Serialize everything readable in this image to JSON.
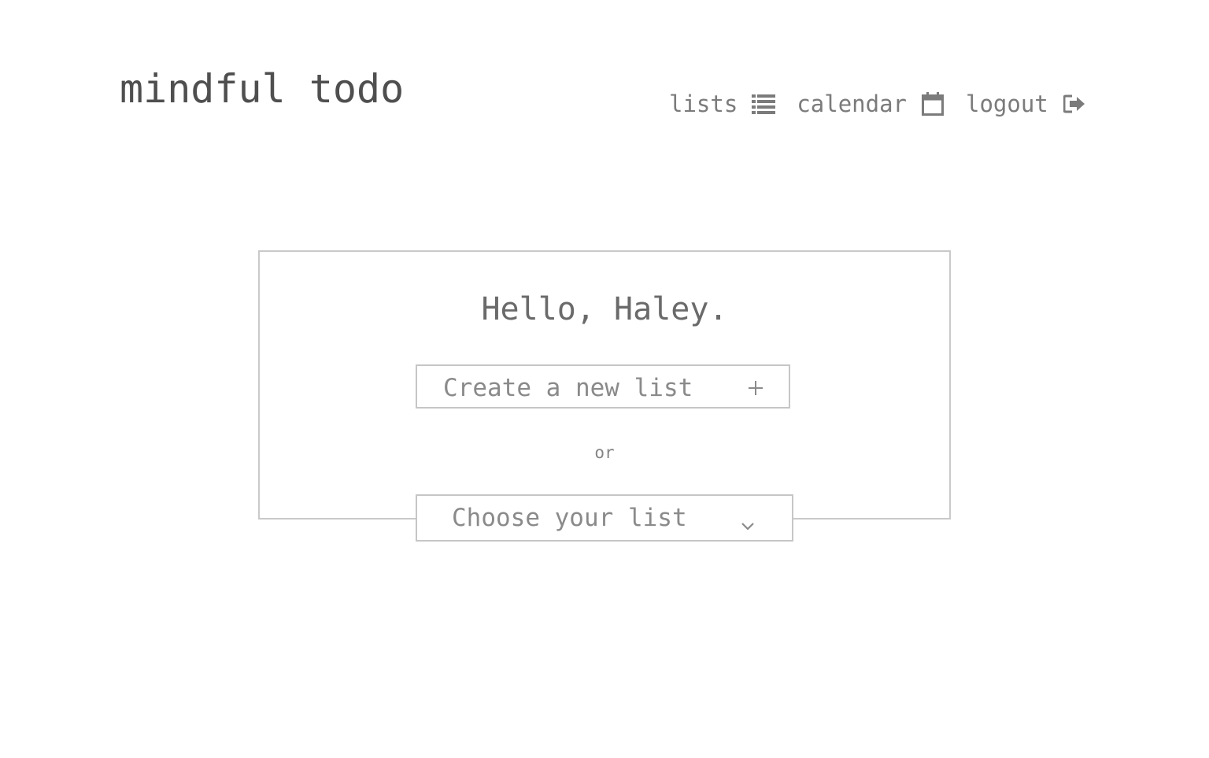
{
  "app": {
    "brand": "mindful todo"
  },
  "nav": {
    "items": [
      {
        "label": "lists",
        "icon": "list-icon"
      },
      {
        "label": "calendar",
        "icon": "calendar-icon"
      },
      {
        "label": "logout",
        "icon": "logout-icon"
      }
    ]
  },
  "main": {
    "greeting": "Hello, Haley.",
    "create_button": {
      "label": "Create a new list",
      "icon": "plus-icon"
    },
    "separator": "or",
    "choose_select": {
      "selected": "Choose your list",
      "icon": "chevron-down-icon"
    }
  },
  "colors": {
    "brand_text": "#4f4f4f",
    "text_gray": "#7b7b7b",
    "border_gray": "#c9c9c9",
    "background": "#ffffff"
  }
}
